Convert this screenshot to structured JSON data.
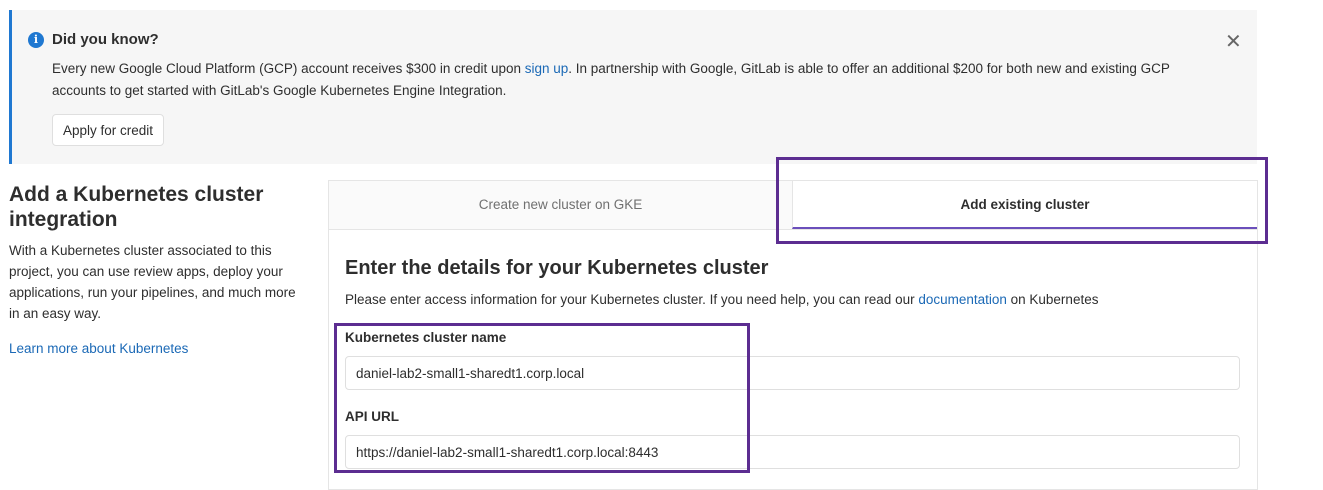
{
  "banner": {
    "title": "Did you know?",
    "info_icon": "info-icon",
    "text_before_link": "Every new Google Cloud Platform (GCP) account receives $300 in credit upon ",
    "link_text": "sign up",
    "text_after_link": ". In partnership with Google, GitLab is able to offer an additional $200 for both new and existing GCP accounts to get started with GitLab's Google Kubernetes Engine Integration.",
    "close_icon": "close-icon",
    "apply_label": "Apply for credit"
  },
  "sidebar": {
    "title": "Add a Kubernetes cluster integration",
    "description": "With a Kubernetes cluster associated to this project, you can use review apps, deploy your applications, run your pipelines, and much more in an easy way.",
    "learn_more": "Learn more about Kubernetes"
  },
  "tabs": [
    {
      "label": "Create new cluster on GKE",
      "active": false
    },
    {
      "label": "Add existing cluster",
      "active": true
    }
  ],
  "form": {
    "title": "Enter the details for your Kubernetes cluster",
    "help_before": "Please enter access information for your Kubernetes cluster. If you need help, you can read our ",
    "help_link": "documentation",
    "help_after": " on Kubernetes",
    "cluster_name_label": "Kubernetes cluster name",
    "cluster_name_value": "daniel-lab2-small1-sharedt1.corp.local",
    "api_url_label": "API URL",
    "api_url_value": "https://daniel-lab2-small1-sharedt1.corp.local:8443"
  },
  "colors": {
    "accent": "#1f78d1",
    "link": "#1b69b6",
    "tab_underline": "#6b4fbb",
    "highlight": "#5c2d91"
  }
}
